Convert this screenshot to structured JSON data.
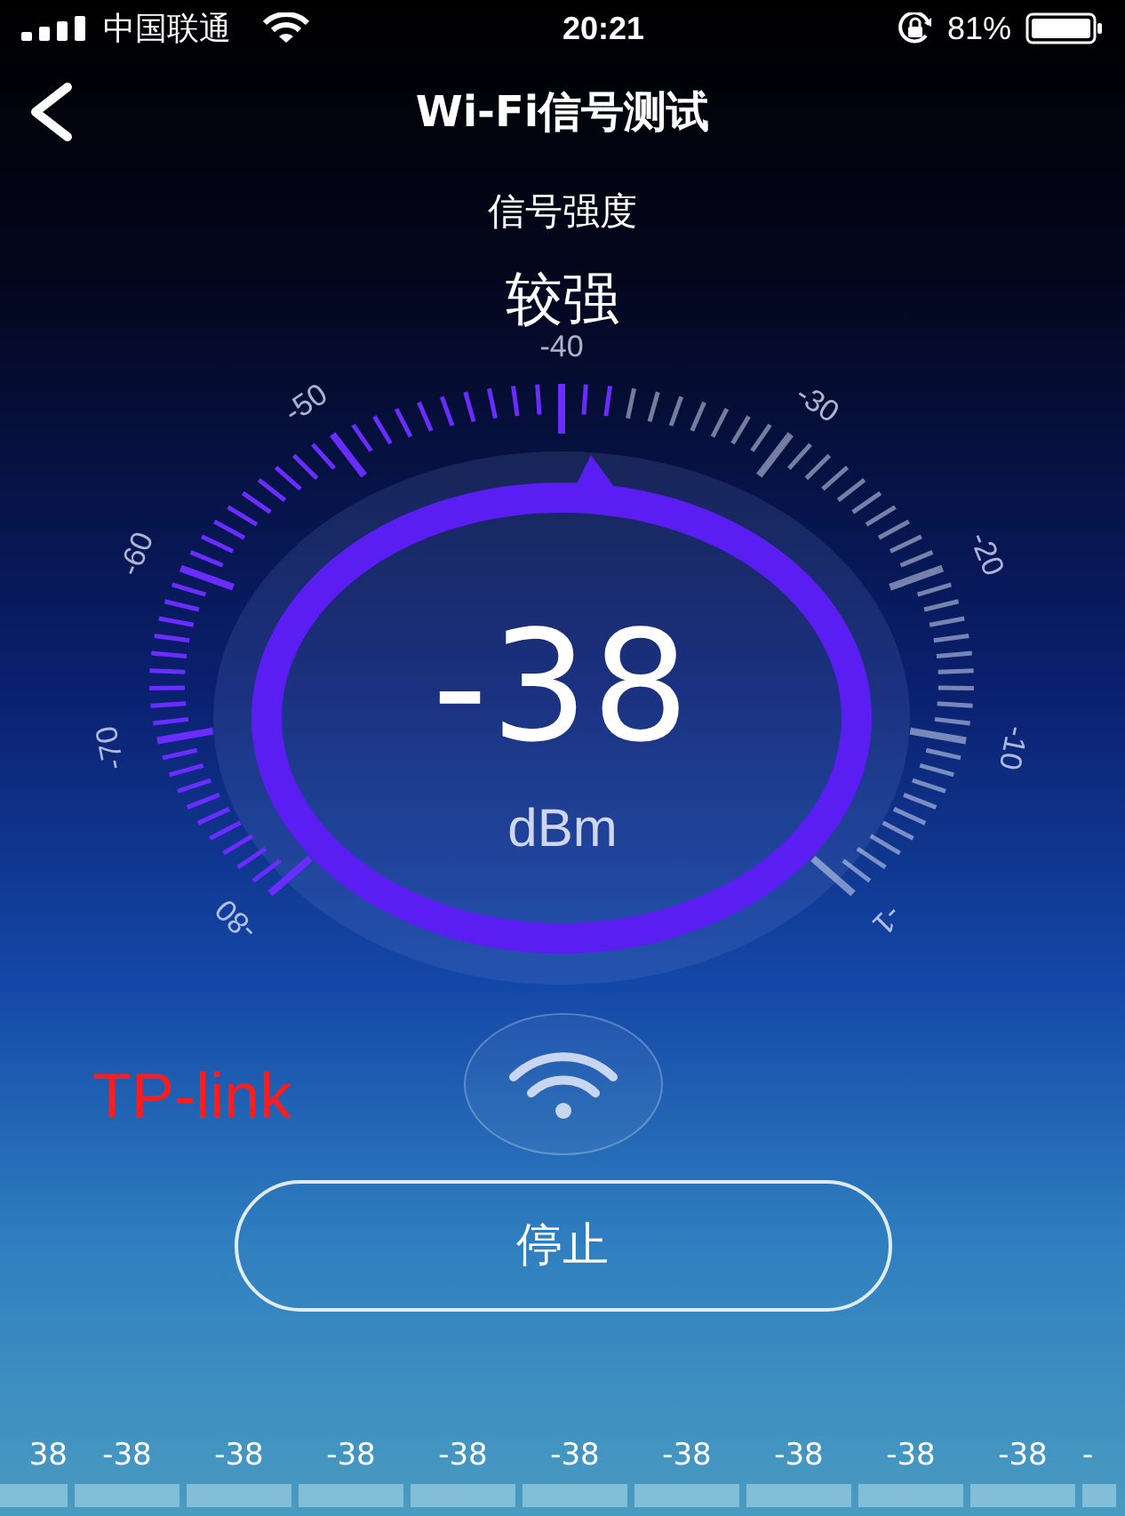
{
  "status_bar": {
    "carrier": "中国联通",
    "time": "20:21",
    "battery": "81%"
  },
  "nav": {
    "title": "Wi-Fi信号测试"
  },
  "signal": {
    "label": "信号强度",
    "quality": "较强",
    "value": "-38",
    "unit": "dBm"
  },
  "gauge": {
    "scale_labels": [
      "-80",
      "-70",
      "-60",
      "-50",
      "-40",
      "-30",
      "-20",
      "-10",
      "-1"
    ]
  },
  "network": {
    "name": "TP-link"
  },
  "stop_button": "停止",
  "history": [
    {
      "value": "38"
    },
    {
      "value": "-38"
    },
    {
      "value": "-38"
    },
    {
      "value": "-38"
    },
    {
      "value": "-38"
    },
    {
      "value": "-38"
    },
    {
      "value": "-38"
    },
    {
      "value": "-38"
    },
    {
      "value": "-38"
    },
    {
      "value": "-38"
    },
    {
      "value": "-"
    }
  ]
}
